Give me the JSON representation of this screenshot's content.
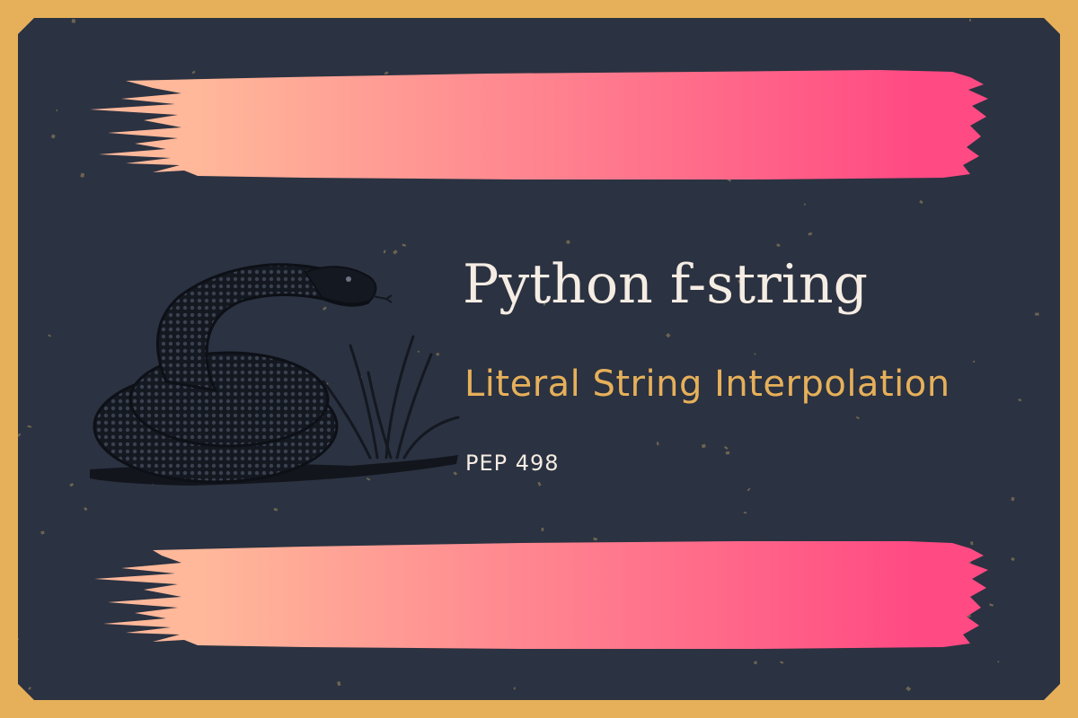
{
  "title": "Python f-string",
  "subtitle": "Literal String Interpolation",
  "pep": "PEP 498",
  "colors": {
    "frame": "#e6b05a",
    "background": "#2b3241",
    "gradient_start": "#ffb89a",
    "gradient_end": "#ff4a83",
    "title_text": "#f5ece3",
    "subtitle_text": "#e6b05a",
    "pep_text": "#f5ece3"
  },
  "illustration": "coiled-snake-engraving"
}
